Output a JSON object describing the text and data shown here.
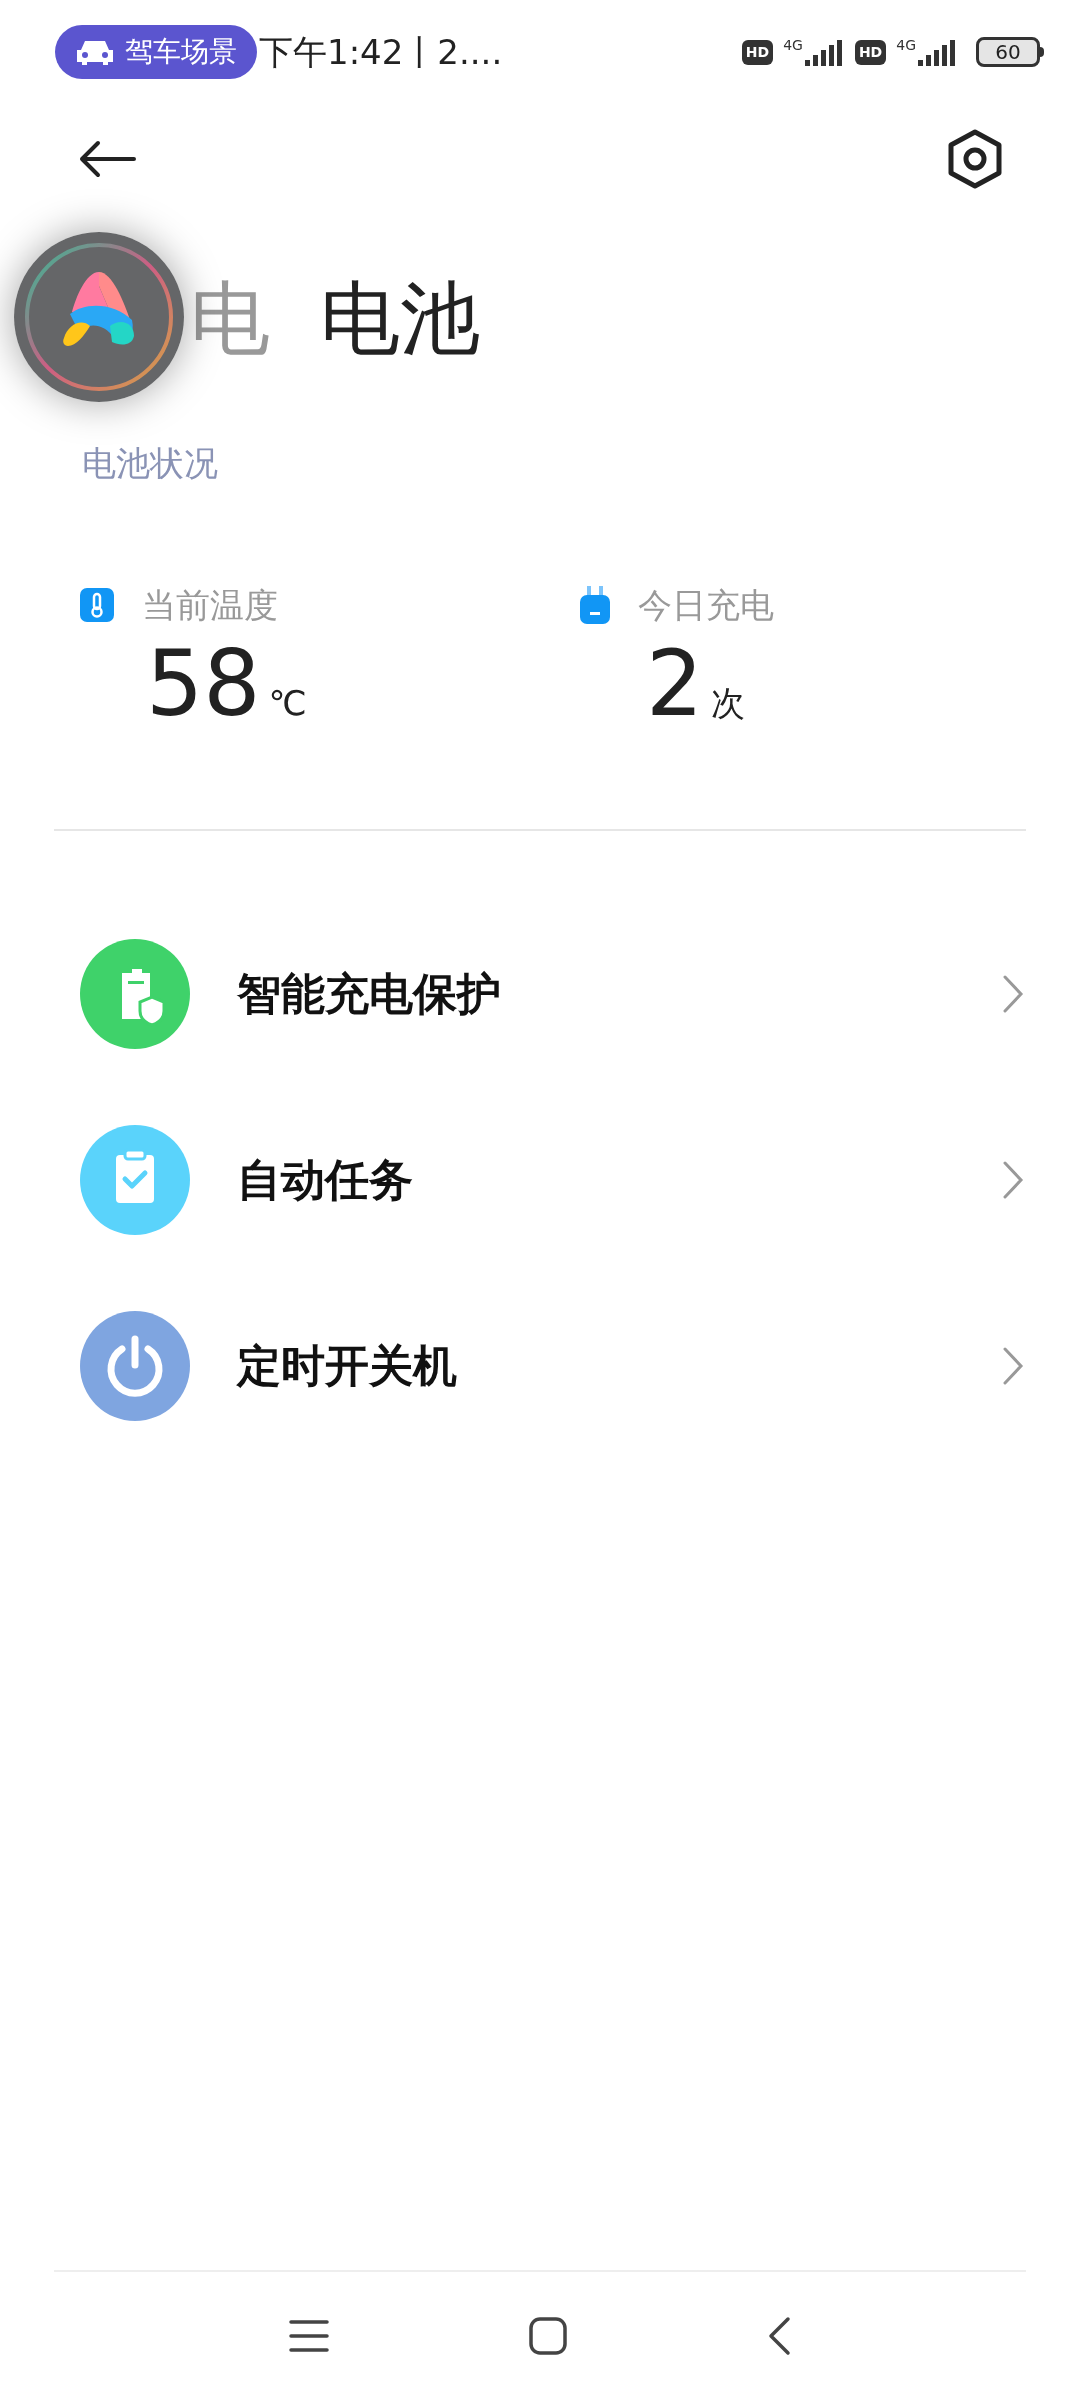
{
  "status_bar": {
    "scene_pill": "驾车场景",
    "time": "下午1:42丨2....",
    "battery": "60",
    "network": [
      {
        "badge": "HD",
        "type": "4G"
      },
      {
        "badge": "HD",
        "type": "4G"
      }
    ]
  },
  "tabs": [
    {
      "label": "电",
      "selected": false
    },
    {
      "label": "电池",
      "selected": true
    }
  ],
  "subtitle": "电池状况",
  "stats": [
    {
      "kind": "temperature",
      "label": "当前温度",
      "value": "58",
      "unit": "℃"
    },
    {
      "kind": "charge",
      "label": "今日充电",
      "value": "2",
      "unit": "次"
    }
  ],
  "menu": [
    {
      "kind": "protection",
      "label": "智能充电保护",
      "color": "#3fd26a"
    },
    {
      "kind": "task",
      "label": "自动任务",
      "color": "#5ad3fb"
    },
    {
      "kind": "power",
      "label": "定时开关机",
      "color": "#7fa5e0"
    }
  ]
}
